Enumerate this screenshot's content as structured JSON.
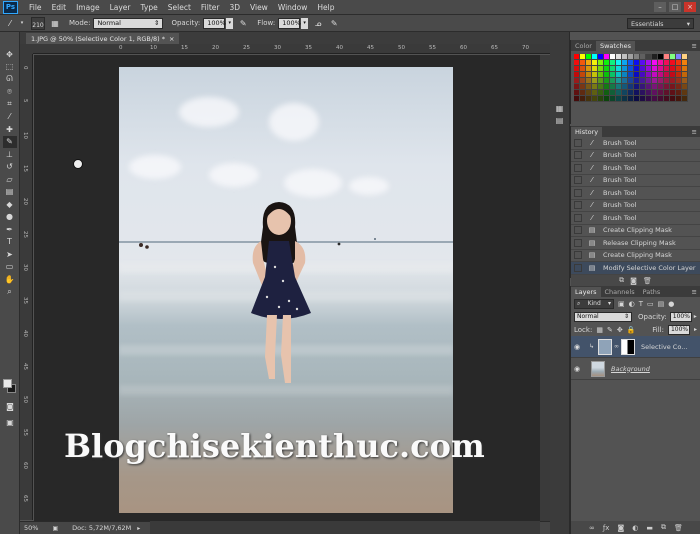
{
  "app": {
    "logo": "Ps"
  },
  "menu": [
    "File",
    "Edit",
    "Image",
    "Layer",
    "Type",
    "Select",
    "Filter",
    "3D",
    "View",
    "Window",
    "Help"
  ],
  "options": {
    "brush_size": "210",
    "mode_label": "Mode:",
    "mode_value": "Normal",
    "opacity_label": "Opacity:",
    "opacity_value": "100%",
    "flow_label": "Flow:",
    "flow_value": "100%",
    "workspace": "Essentials"
  },
  "document": {
    "tab_title": "1.JPG @ 50% (Selective Color 1, RGB/8) *",
    "watermark": "Blogchisekienthuc.com"
  },
  "ruler_h": [
    "0",
    "10",
    "15",
    "20",
    "25",
    "30",
    "35",
    "40",
    "45",
    "50",
    "55",
    "60",
    "65",
    "70",
    "75"
  ],
  "ruler_v": [
    "0",
    "5",
    "10",
    "15",
    "20",
    "25",
    "30",
    "35",
    "40",
    "45",
    "50",
    "55",
    "60",
    "65"
  ],
  "status": {
    "zoom": "50%",
    "doc": "Doc: 5,72M/7,62M"
  },
  "color_panel": {
    "tab_color": "Color",
    "tab_swatches": "Swatches"
  },
  "history": {
    "title": "History",
    "items": [
      {
        "label": "Brush Tool",
        "icon": "brush-icon"
      },
      {
        "label": "Brush Tool",
        "icon": "brush-icon"
      },
      {
        "label": "Brush Tool",
        "icon": "brush-icon"
      },
      {
        "label": "Brush Tool",
        "icon": "brush-icon"
      },
      {
        "label": "Brush Tool",
        "icon": "brush-icon"
      },
      {
        "label": "Brush Tool",
        "icon": "brush-icon"
      },
      {
        "label": "Brush Tool",
        "icon": "brush-icon"
      },
      {
        "label": "Create Clipping Mask",
        "icon": "document-icon"
      },
      {
        "label": "Release Clipping Mask",
        "icon": "document-icon"
      },
      {
        "label": "Create Clipping Mask",
        "icon": "document-icon"
      },
      {
        "label": "Modify Selective Color Layer",
        "icon": "document-icon"
      }
    ]
  },
  "layers": {
    "tab_layers": "Layers",
    "tab_channels": "Channels",
    "tab_paths": "Paths",
    "kind": "Kind",
    "blend": "Normal",
    "opacity_label": "Opacity:",
    "opacity": "100%",
    "lock_label": "Lock:",
    "fill_label": "Fill:",
    "fill": "100%",
    "rows": [
      {
        "name": "Selective Co..."
      },
      {
        "name": "Background"
      }
    ]
  }
}
